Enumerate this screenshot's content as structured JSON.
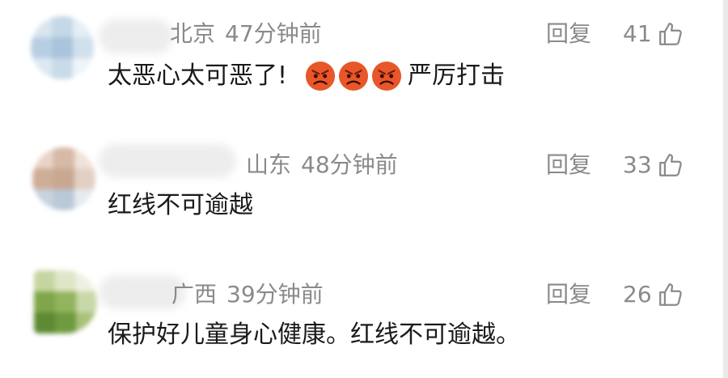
{
  "comments": [
    {
      "location": "北京",
      "time": "47分钟前",
      "reply_label": "回复",
      "likes": "41",
      "text_before": "太恶心太可恶了!",
      "emojis": [
        "angry-face-icon",
        "angry-face-icon",
        "angry-face-icon"
      ],
      "text_after": "严厉打击"
    },
    {
      "location": "山东",
      "time": "48分钟前",
      "reply_label": "回复",
      "likes": "33",
      "text": "红线不可逾越"
    },
    {
      "location": "广西",
      "time": "39分钟前",
      "reply_label": "回复",
      "likes": "26",
      "text": "保护好儿童身心健康。红线不可逾越。"
    }
  ],
  "colors": {
    "meta": "#8a8a8a",
    "text": "#1a1a1a",
    "emoji": "#e8562a"
  }
}
